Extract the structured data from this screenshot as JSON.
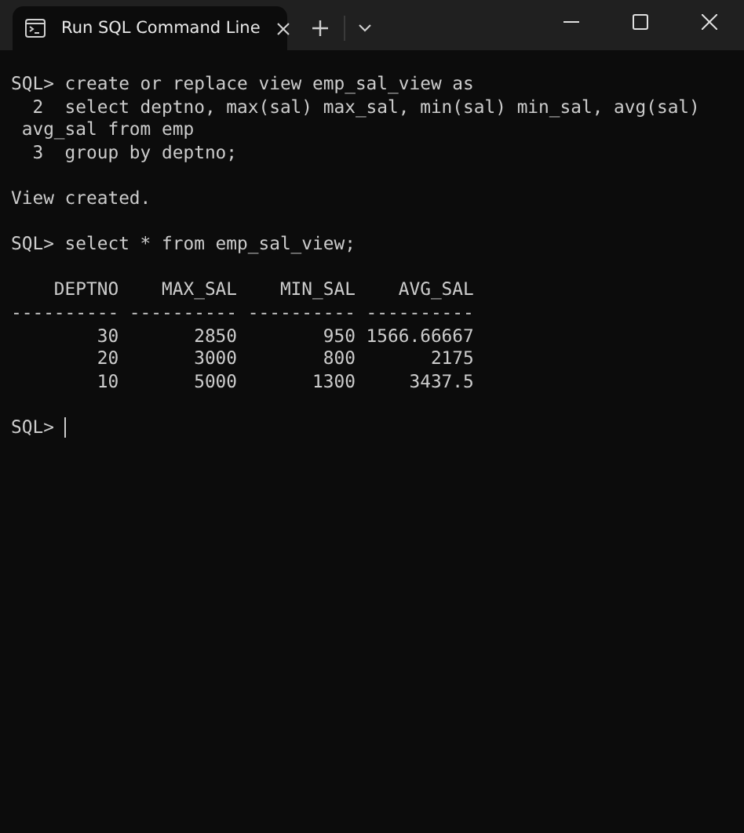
{
  "window": {
    "title": "Run SQL Command Line"
  },
  "terminal": {
    "blocks": [
      {
        "lines": [
          "SQL> create or replace view emp_sal_view as",
          "  2  select deptno, max(sal) max_sal, min(sal) min_sal, avg(sal)",
          " avg_sal from emp",
          "  3  group by deptno;"
        ]
      },
      {
        "lines": [
          "View created."
        ]
      },
      {
        "lines": [
          "SQL> select * from emp_sal_view;"
        ]
      },
      {
        "lines": [
          "    DEPTNO    MAX_SAL    MIN_SAL    AVG_SAL",
          "---------- ---------- ---------- ----------",
          "        30       2850        950 1566.66667",
          "        20       3000        800       2175",
          "        10       5000       1300     3437.5"
        ]
      }
    ],
    "prompt": "SQL>"
  }
}
